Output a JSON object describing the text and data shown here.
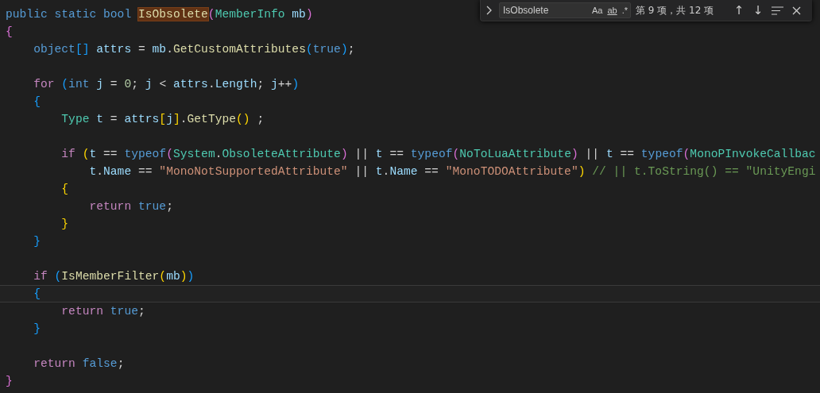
{
  "editor": {
    "lines": [
      {
        "current": false,
        "tokens": [
          {
            "text": "public static bool ",
            "kind": "kw"
          },
          {
            "text": "IsObsolete",
            "kind": "func",
            "match": true
          },
          {
            "text": "(",
            "kind": "b2"
          },
          {
            "text": "MemberInfo",
            "kind": "type"
          },
          {
            "text": " mb",
            "kind": "var"
          },
          {
            "text": ")",
            "kind": "b2"
          }
        ]
      },
      {
        "current": false,
        "tokens": [
          {
            "text": "{",
            "kind": "b2"
          }
        ]
      },
      {
        "current": false,
        "tokens": [
          {
            "text": "    object",
            "kind": "kw"
          },
          {
            "text": "[]",
            "kind": "b3"
          },
          {
            "text": " attrs",
            "kind": "var"
          },
          {
            "text": " = ",
            "kind": "plain"
          },
          {
            "text": "mb",
            "kind": "var"
          },
          {
            "text": ".",
            "kind": "plain"
          },
          {
            "text": "GetCustomAttributes",
            "kind": "func"
          },
          {
            "text": "(",
            "kind": "b3"
          },
          {
            "text": "true",
            "kind": "kw"
          },
          {
            "text": ")",
            "kind": "b3"
          },
          {
            "text": ";",
            "kind": "plain"
          }
        ]
      },
      {
        "current": false
      },
      {
        "current": false,
        "tokens": [
          {
            "text": "    for",
            "kind": "ctrl"
          },
          {
            "text": " (",
            "kind": "b3"
          },
          {
            "text": "int",
            "kind": "kw"
          },
          {
            "text": " j",
            "kind": "var"
          },
          {
            "text": " = ",
            "kind": "plain"
          },
          {
            "text": "0",
            "kind": "num"
          },
          {
            "text": "; ",
            "kind": "plain"
          },
          {
            "text": "j",
            "kind": "var"
          },
          {
            "text": " < ",
            "kind": "plain"
          },
          {
            "text": "attrs",
            "kind": "var"
          },
          {
            "text": ".",
            "kind": "plain"
          },
          {
            "text": "Length",
            "kind": "var"
          },
          {
            "text": "; ",
            "kind": "plain"
          },
          {
            "text": "j",
            "kind": "var"
          },
          {
            "text": "++",
            "kind": "plain"
          },
          {
            "text": ")",
            "kind": "b3"
          }
        ]
      },
      {
        "current": false,
        "tokens": [
          {
            "text": "    {",
            "kind": "b3"
          }
        ]
      },
      {
        "current": false,
        "tokens": [
          {
            "text": "        Type",
            "kind": "type"
          },
          {
            "text": " t",
            "kind": "var"
          },
          {
            "text": " = ",
            "kind": "plain"
          },
          {
            "text": "attrs",
            "kind": "var"
          },
          {
            "text": "[",
            "kind": "b1"
          },
          {
            "text": "j",
            "kind": "var"
          },
          {
            "text": "]",
            "kind": "b1"
          },
          {
            "text": ".",
            "kind": "plain"
          },
          {
            "text": "GetType",
            "kind": "func"
          },
          {
            "text": "()",
            "kind": "b1"
          },
          {
            "text": " ;",
            "kind": "plain"
          }
        ]
      },
      {
        "current": false
      },
      {
        "current": false,
        "tokens": [
          {
            "text": "        if",
            "kind": "ctrl"
          },
          {
            "text": " (",
            "kind": "b1"
          },
          {
            "text": "t",
            "kind": "var"
          },
          {
            "text": " == ",
            "kind": "plain"
          },
          {
            "text": "typeof",
            "kind": "kw"
          },
          {
            "text": "(",
            "kind": "b2"
          },
          {
            "text": "System",
            "kind": "type"
          },
          {
            "text": ".",
            "kind": "plain"
          },
          {
            "text": "ObsoleteAttribute",
            "kind": "type"
          },
          {
            "text": ")",
            "kind": "b2"
          },
          {
            "text": " || ",
            "kind": "plain"
          },
          {
            "text": "t",
            "kind": "var"
          },
          {
            "text": " == ",
            "kind": "plain"
          },
          {
            "text": "typeof",
            "kind": "kw"
          },
          {
            "text": "(",
            "kind": "b2"
          },
          {
            "text": "NoToLuaAttribute",
            "kind": "type"
          },
          {
            "text": ")",
            "kind": "b2"
          },
          {
            "text": " || ",
            "kind": "plain"
          },
          {
            "text": "t",
            "kind": "var"
          },
          {
            "text": " == ",
            "kind": "plain"
          },
          {
            "text": "typeof",
            "kind": "kw"
          },
          {
            "text": "(",
            "kind": "b2"
          },
          {
            "text": "MonoPInvokeCallbac",
            "kind": "type"
          }
        ]
      },
      {
        "current": false,
        "tokens": [
          {
            "text": "            t",
            "kind": "var"
          },
          {
            "text": ".",
            "kind": "plain"
          },
          {
            "text": "Name",
            "kind": "var"
          },
          {
            "text": " == ",
            "kind": "plain"
          },
          {
            "text": "\"MonoNotSupportedAttribute\"",
            "kind": "str"
          },
          {
            "text": " || ",
            "kind": "plain"
          },
          {
            "text": "t",
            "kind": "var"
          },
          {
            "text": ".",
            "kind": "plain"
          },
          {
            "text": "Name",
            "kind": "var"
          },
          {
            "text": " == ",
            "kind": "plain"
          },
          {
            "text": "\"MonoTODOAttribute\"",
            "kind": "str"
          },
          {
            "text": ")",
            "kind": "b1"
          },
          {
            "text": " // || t.ToString() == \"UnityEngi",
            "kind": "comment"
          }
        ]
      },
      {
        "current": false,
        "tokens": [
          {
            "text": "        {",
            "kind": "b1"
          }
        ]
      },
      {
        "current": false,
        "tokens": [
          {
            "text": "            return",
            "kind": "ctrl"
          },
          {
            "text": " true",
            "kind": "kw"
          },
          {
            "text": ";",
            "kind": "plain"
          }
        ]
      },
      {
        "current": false,
        "tokens": [
          {
            "text": "        }",
            "kind": "b1"
          }
        ]
      },
      {
        "current": false,
        "tokens": [
          {
            "text": "    }",
            "kind": "b3"
          }
        ]
      },
      {
        "current": false
      },
      {
        "current": false,
        "tokens": [
          {
            "text": "    if",
            "kind": "ctrl"
          },
          {
            "text": " (",
            "kind": "b3"
          },
          {
            "text": "IsMemberFilter",
            "kind": "func"
          },
          {
            "text": "(",
            "kind": "b1"
          },
          {
            "text": "mb",
            "kind": "var"
          },
          {
            "text": ")",
            "kind": "b1"
          },
          {
            "text": ")",
            "kind": "b3"
          }
        ]
      },
      {
        "current": true,
        "tokens": [
          {
            "text": "    {",
            "kind": "b3"
          }
        ]
      },
      {
        "current": false,
        "tokens": [
          {
            "text": "        return",
            "kind": "ctrl"
          },
          {
            "text": " true",
            "kind": "kw"
          },
          {
            "text": ";",
            "kind": "plain"
          }
        ]
      },
      {
        "current": false,
        "tokens": [
          {
            "text": "    }",
            "kind": "b3"
          }
        ]
      },
      {
        "current": false
      },
      {
        "current": false,
        "tokens": [
          {
            "text": "    return",
            "kind": "ctrl"
          },
          {
            "text": " false",
            "kind": "kw"
          },
          {
            "text": ";",
            "kind": "plain"
          }
        ]
      },
      {
        "current": false,
        "tokens": [
          {
            "text": "}",
            "kind": "b2"
          }
        ]
      }
    ]
  },
  "find_widget": {
    "value": "IsObsolete",
    "options": [
      {
        "label": "Aa",
        "kind": "case",
        "on": false
      },
      {
        "label": "ab",
        "kind": "word",
        "on": false
      },
      {
        "label": ".*",
        "kind": "regex",
        "on": false
      }
    ],
    "count": "第 9 项，共 12 项",
    "previous": "↑",
    "next": "↓"
  }
}
